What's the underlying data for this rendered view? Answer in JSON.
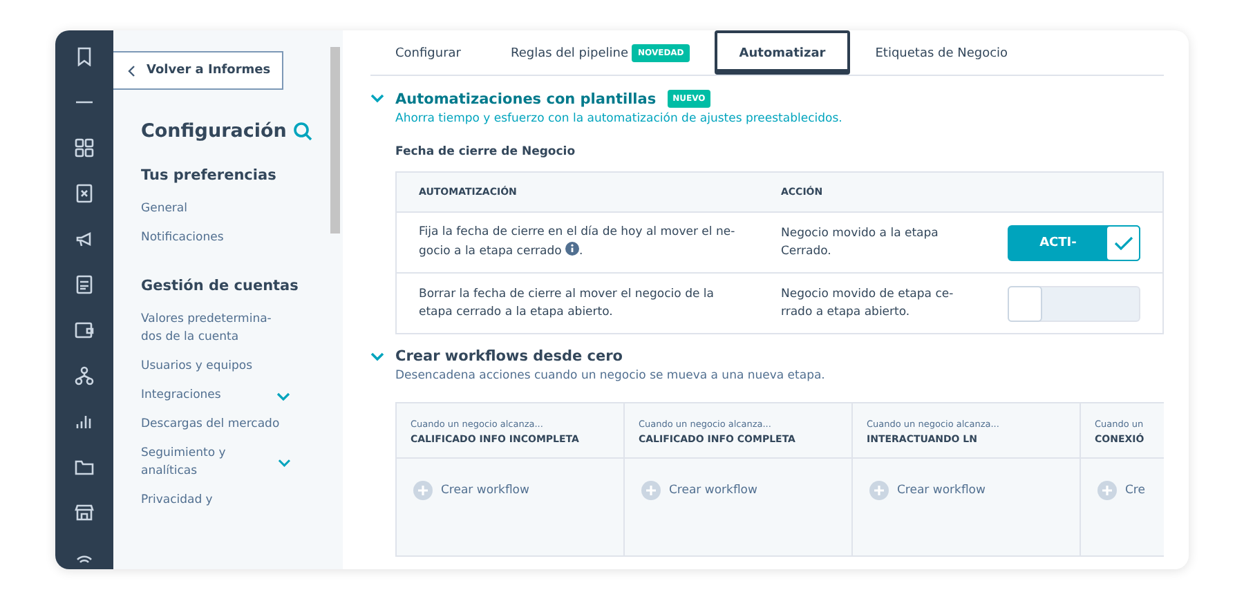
{
  "back_button": {
    "label": "Volver a Informes"
  },
  "sidebar": {
    "title": "Configuración",
    "sections": [
      {
        "heading": "Tus preferencias",
        "items": [
          {
            "label": "General",
            "expanded": false
          },
          {
            "label": "Notificaciones",
            "expanded": false
          }
        ]
      },
      {
        "heading": "Gestión de cuentas",
        "items": [
          {
            "label": "Valores predetermina-dos de la cuenta",
            "expanded": false
          },
          {
            "label": "Usuarios y equipos",
            "expanded": false
          },
          {
            "label": "Integraciones",
            "expanded": true
          },
          {
            "label": "Descargas del mercado",
            "expanded": false
          },
          {
            "label": "Seguimiento y analíticas",
            "expanded": true
          },
          {
            "label": "Privacidad y",
            "expanded": false
          }
        ]
      }
    ]
  },
  "tabs": [
    {
      "label": "Configurar",
      "selected": false
    },
    {
      "label": "Reglas del pipeline",
      "badge": "NOVEDAD",
      "selected": false
    },
    {
      "label": "Automatizar",
      "selected": true
    },
    {
      "label": "Etiquetas de Negocio",
      "selected": false
    }
  ],
  "templates_section": {
    "title": "Automatizaciones con plantillas",
    "badge": "NUEVO",
    "expanded": true,
    "subtitle": "Ahorra tiempo y esfuerzo con la automatización de ajustes preestablecidos.",
    "group_title": "Fecha de cierre de Negocio",
    "table": {
      "columns": [
        "AUTOMATIZACIÓN",
        "ACCIÓN"
      ],
      "rows": [
        {
          "automation": "Fija la fecha de cierre en el día de hoy al mover el ne-gocio a la etapa cerrado",
          "info": true,
          "automation_end": ".",
          "action": "Negocio movido a la etapa Cerrado.",
          "toggle": {
            "on": true,
            "label": "ACTI-"
          }
        },
        {
          "automation": "Borrar la fecha de cierre al mover el negocio de la etapa cerrado a la etapa abierto.",
          "info": false,
          "action": "Negocio movido de etapa ce-rrado a etapa abierto.",
          "toggle": {
            "on": false
          }
        }
      ]
    }
  },
  "workflows_section": {
    "title": "Crear workflows desde cero",
    "expanded": true,
    "subtitle": "Desencadena acciones cuando un negocio se mueva a una nueva etapa.",
    "stages": [
      {
        "caption": "Cuando un negocio alcanza...",
        "stage": "CALIFICADO INFO INCOMPLETA",
        "action": "Crear workflow"
      },
      {
        "caption": "Cuando un negocio alcanza...",
        "stage": "CALIFICADO INFO COMPLETA",
        "action": "Crear workflow"
      },
      {
        "caption": "Cuando un negocio alcanza...",
        "stage": "INTERACTUANDO LN",
        "action": "Crear workflow"
      },
      {
        "caption": "Cuando un",
        "stage": "CONEXIÓ",
        "action": "Cre"
      }
    ]
  }
}
